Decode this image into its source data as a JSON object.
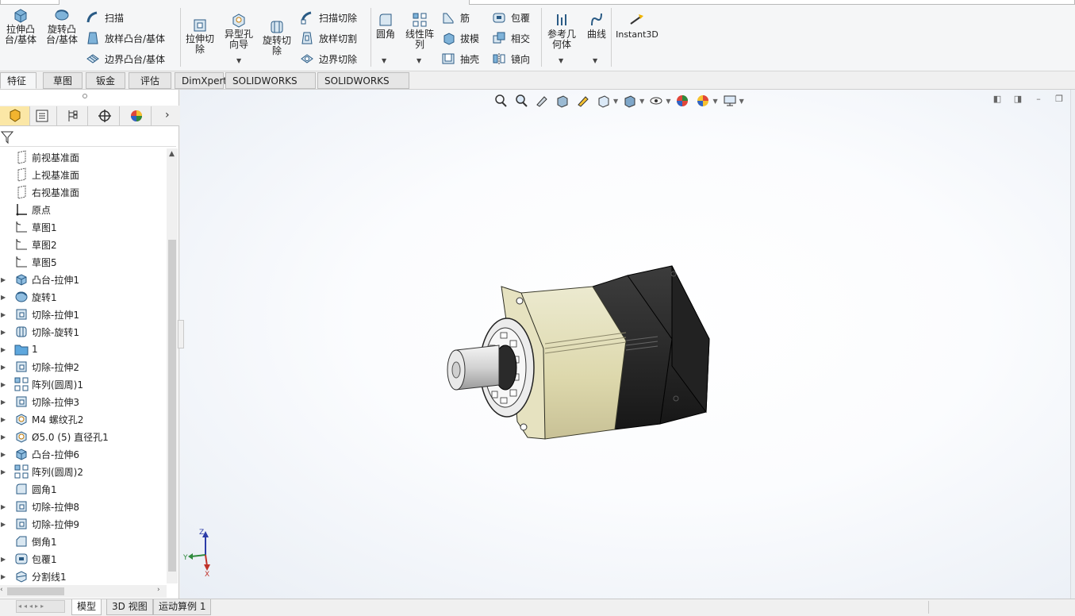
{
  "ribbon": {
    "extrude_boss": "拉伸凸\n台/基体",
    "revolve_boss": "旋转凸\n台/基体",
    "sweep": "扫描",
    "loft_boss": "放样凸台/基体",
    "boundary_boss": "边界凸台/基体",
    "extrude_cut": "拉伸切\n除",
    "hole_wizard": "异型孔\n向导",
    "revolve_cut": "旋转切\n除",
    "sweep_cut": "扫描切除",
    "loft_cut": "放样切割",
    "boundary_cut": "边界切除",
    "fillet": "圆角",
    "linear_pattern": "线性阵\n列",
    "rib": "筋",
    "draft": "拔模",
    "shell": "抽壳",
    "wrap": "包覆",
    "intersect": "相交",
    "mirror": "镜向",
    "reference_geometry": "参考几\n何体",
    "curves": "曲线",
    "instant3d": "Instant3D"
  },
  "command_tabs": [
    "特征",
    "草图",
    "钣金",
    "评估",
    "DimXpert",
    "SOLIDWORKS 插件",
    "SOLIDWORKS MBD"
  ],
  "tree": {
    "items": [
      {
        "label": "前视基准面",
        "icon": "plane-icon",
        "expandable": false
      },
      {
        "label": "上视基准面",
        "icon": "plane-icon",
        "expandable": false
      },
      {
        "label": "右视基准面",
        "icon": "plane-icon",
        "expandable": false
      },
      {
        "label": "原点",
        "icon": "origin-icon",
        "expandable": false
      },
      {
        "label": "草图1",
        "icon": "sketch-icon",
        "expandable": false
      },
      {
        "label": "草图2",
        "icon": "sketch-icon",
        "expandable": false
      },
      {
        "label": "草图5",
        "icon": "sketch-icon",
        "expandable": false
      },
      {
        "label": "凸台-拉伸1",
        "icon": "extrude-icon",
        "expandable": true
      },
      {
        "label": "旋转1",
        "icon": "revolve-icon",
        "expandable": true
      },
      {
        "label": "切除-拉伸1",
        "icon": "cut-extrude-icon",
        "expandable": true
      },
      {
        "label": "切除-旋转1",
        "icon": "cut-revolve-icon",
        "expandable": true
      },
      {
        "label": "1",
        "icon": "folder-icon",
        "expandable": true
      },
      {
        "label": "切除-拉伸2",
        "icon": "cut-extrude-icon",
        "expandable": true
      },
      {
        "label": "阵列(圆周)1",
        "icon": "pattern-icon",
        "expandable": true
      },
      {
        "label": "切除-拉伸3",
        "icon": "cut-extrude-icon",
        "expandable": true
      },
      {
        "label": "M4 螺纹孔2",
        "icon": "hole-icon",
        "expandable": true
      },
      {
        "label": "Ø5.0 (5) 直径孔1",
        "icon": "hole-icon",
        "expandable": true
      },
      {
        "label": "凸台-拉伸6",
        "icon": "extrude-icon",
        "expandable": true
      },
      {
        "label": "阵列(圆周)2",
        "icon": "pattern-icon",
        "expandable": true
      },
      {
        "label": "圆角1",
        "icon": "fillet-icon",
        "expandable": false
      },
      {
        "label": "切除-拉伸8",
        "icon": "cut-extrude-icon",
        "expandable": true
      },
      {
        "label": "切除-拉伸9",
        "icon": "cut-extrude-icon",
        "expandable": true
      },
      {
        "label": "倒角1",
        "icon": "chamfer-icon",
        "expandable": false
      },
      {
        "label": "包覆1",
        "icon": "wrap-icon",
        "expandable": true
      },
      {
        "label": "分割线1",
        "icon": "split-line-icon",
        "expandable": true
      }
    ]
  },
  "bottom_tabs": [
    "模型",
    "3D 视图",
    "运动算例 1"
  ],
  "triad": {
    "z": "Z",
    "y": "Y",
    "x": "X"
  },
  "colors": {
    "accent": "#fbe7a6",
    "body_cream": "#e2dcb2",
    "body_dark": "#2b2b2b"
  }
}
